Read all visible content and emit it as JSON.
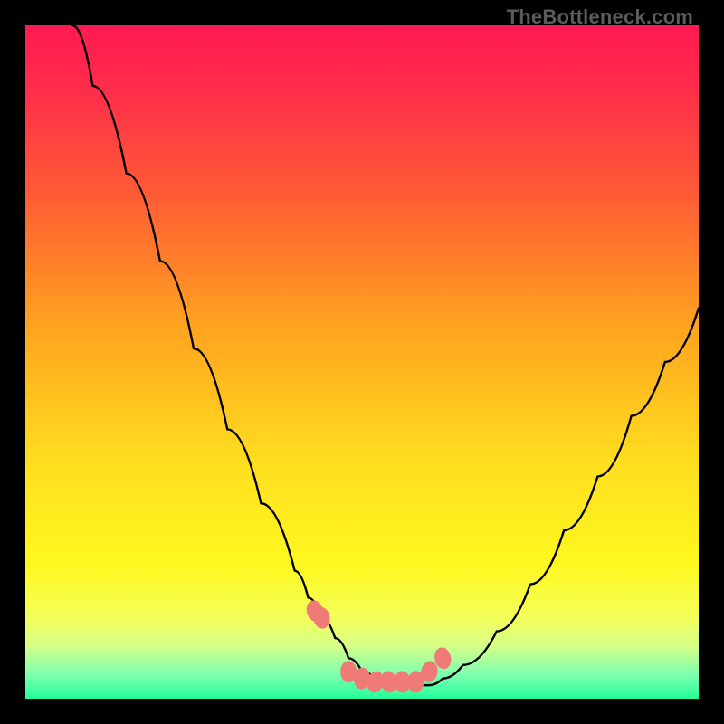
{
  "watermark": "TheBottleneck.com",
  "chart_data": {
    "type": "line",
    "title": "",
    "xlabel": "",
    "ylabel": "",
    "xlim": [
      0,
      100
    ],
    "ylim": [
      0,
      100
    ],
    "x": [
      7,
      10,
      15,
      20,
      25,
      30,
      35,
      40,
      42,
      44,
      46,
      48,
      50,
      52,
      54,
      56,
      58,
      60,
      62,
      65,
      70,
      75,
      80,
      85,
      90,
      95,
      100
    ],
    "values": [
      100,
      91,
      78,
      65,
      52,
      40,
      29,
      19,
      15,
      12,
      9,
      6,
      4,
      3,
      2,
      2,
      2,
      2,
      3,
      5,
      10,
      17,
      25,
      33,
      42,
      50,
      58
    ],
    "series": [
      {
        "name": "bottleneck-curve",
        "type": "line"
      },
      {
        "name": "optimum-markers",
        "type": "scatter",
        "x": [
          43,
          44,
          48,
          50,
          52,
          54,
          56,
          58,
          60,
          62
        ],
        "values": [
          13,
          12,
          4,
          3,
          2.5,
          2.5,
          2.5,
          2.5,
          4,
          6
        ]
      }
    ],
    "gradient_stops": [
      {
        "pos": 0.0,
        "color": "#ff1a52"
      },
      {
        "pos": 0.1,
        "color": "#ff2e4a"
      },
      {
        "pos": 0.25,
        "color": "#ff5b35"
      },
      {
        "pos": 0.45,
        "color": "#ffa41f"
      },
      {
        "pos": 0.65,
        "color": "#ffde1f"
      },
      {
        "pos": 0.8,
        "color": "#fff81f"
      },
      {
        "pos": 0.88,
        "color": "#f3ff5a"
      },
      {
        "pos": 0.92,
        "color": "#d8ff86"
      },
      {
        "pos": 0.965,
        "color": "#7dffb0"
      },
      {
        "pos": 1.0,
        "color": "#22ff9a"
      }
    ],
    "marker_color": "#ef7a76",
    "curve_color": "#000000"
  }
}
